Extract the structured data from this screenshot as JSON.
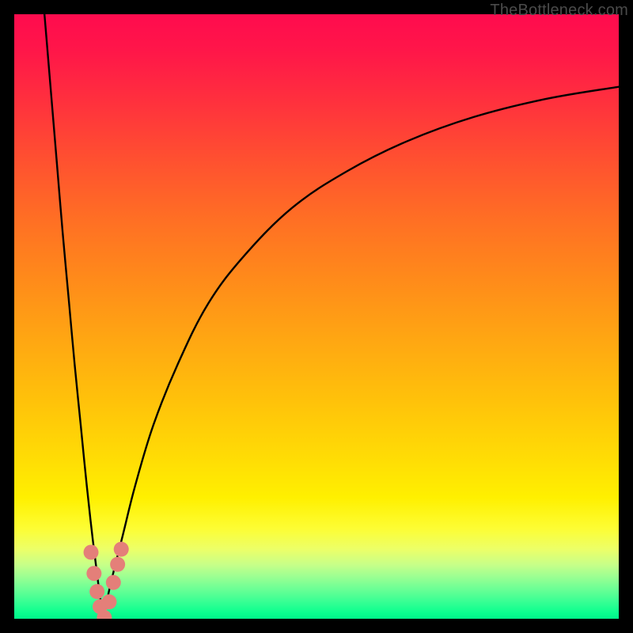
{
  "watermark": "TheBottleneck.com",
  "chart_data": {
    "type": "line",
    "title": "",
    "xlabel": "",
    "ylabel": "",
    "xlim": [
      0,
      100
    ],
    "ylim": [
      0,
      100
    ],
    "series": [
      {
        "name": "left-branch",
        "x": [
          5,
          6,
          7,
          8,
          9,
          10,
          11,
          12,
          13,
          14,
          14.7
        ],
        "y": [
          100,
          88,
          76,
          64,
          53,
          42,
          32,
          22,
          13,
          5,
          0
        ]
      },
      {
        "name": "right-branch",
        "x": [
          14.7,
          16,
          18,
          20,
          23,
          27,
          32,
          38,
          46,
          55,
          65,
          76,
          88,
          100
        ],
        "y": [
          0,
          6,
          14,
          22,
          32,
          42,
          52,
          60,
          68,
          74,
          79,
          83,
          86,
          88
        ]
      }
    ],
    "markers": {
      "name": "dip-highlight",
      "color": "#e47f79",
      "points": [
        {
          "x": 12.7,
          "y": 11
        },
        {
          "x": 13.2,
          "y": 7.5
        },
        {
          "x": 13.7,
          "y": 4.5
        },
        {
          "x": 14.2,
          "y": 2
        },
        {
          "x": 14.9,
          "y": 0.2
        },
        {
          "x": 15.7,
          "y": 2.8
        },
        {
          "x": 16.4,
          "y": 6
        },
        {
          "x": 17.1,
          "y": 9
        },
        {
          "x": 17.7,
          "y": 11.5
        }
      ]
    },
    "gradient_stops": [
      {
        "pos": 0,
        "color": "#ff0b4e"
      },
      {
        "pos": 25,
        "color": "#ff5a2c"
      },
      {
        "pos": 50,
        "color": "#ffa015"
      },
      {
        "pos": 75,
        "color": "#ffe103"
      },
      {
        "pos": 90,
        "color": "#d6ff7e"
      },
      {
        "pos": 100,
        "color": "#00f48a"
      }
    ]
  }
}
